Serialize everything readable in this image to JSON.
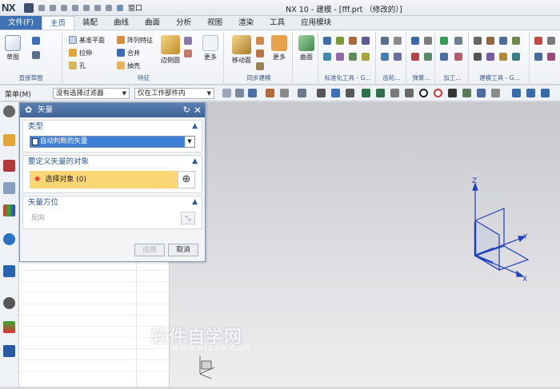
{
  "app": {
    "logo": "NX",
    "window_menu": "窗口",
    "title": "NX 10 - 建模 - [fff.prt （修改的）]"
  },
  "tabs": {
    "file": "文件(F)",
    "items": [
      "主页",
      "装配",
      "曲线",
      "曲面",
      "分析",
      "视图",
      "渲染",
      "工具",
      "应用模块"
    ],
    "active_index": 0
  },
  "ribbon": {
    "sketch": "草图",
    "datum_plane": "基准平面",
    "extrude": "拉伸",
    "hole": "孔",
    "pattern_feature": "阵列特征",
    "unite": "合并",
    "shell": "抽壳",
    "edge_blend": "边倒圆",
    "more1": "更多",
    "move_face": "移动面",
    "more2": "更多",
    "surface": "曲面",
    "more3": "更多",
    "groups": {
      "direct_sketch": "直接草图",
      "feature": "特征",
      "sync_modeling": "同步建模",
      "std_tools": "标准化工具 - G...",
      "gear": "齿轮...",
      "spring": "弹簧...",
      "machining": "加工...",
      "building_tools": "建模工具 - G..."
    }
  },
  "selection_bar": {
    "menu": "菜单(M)",
    "filter": "没有选择过滤器",
    "scope": "仅在工作部件内"
  },
  "dialog": {
    "title": "矢量",
    "type_section": "类型",
    "type_value": "自动判断的矢量",
    "object_section": "要定义矢量的对象",
    "select_object": "选择对象 (0)",
    "orientation_section": "矢量方位",
    "reverse": "反向",
    "apply": "应用",
    "cancel": "取消"
  },
  "triad": {
    "z": "Z",
    "y": "Y",
    "x": "X"
  },
  "watermark": {
    "main": "软件自学网",
    "url": "WWW.RJZXW.COM"
  },
  "colors": {
    "file_tab": "#3f72b5",
    "dialog_header": "#4a6fa5",
    "selection_highlight": "#fbd675",
    "combo_selected": "#3d7fd6",
    "triad_blue": "#1f3fb8"
  }
}
